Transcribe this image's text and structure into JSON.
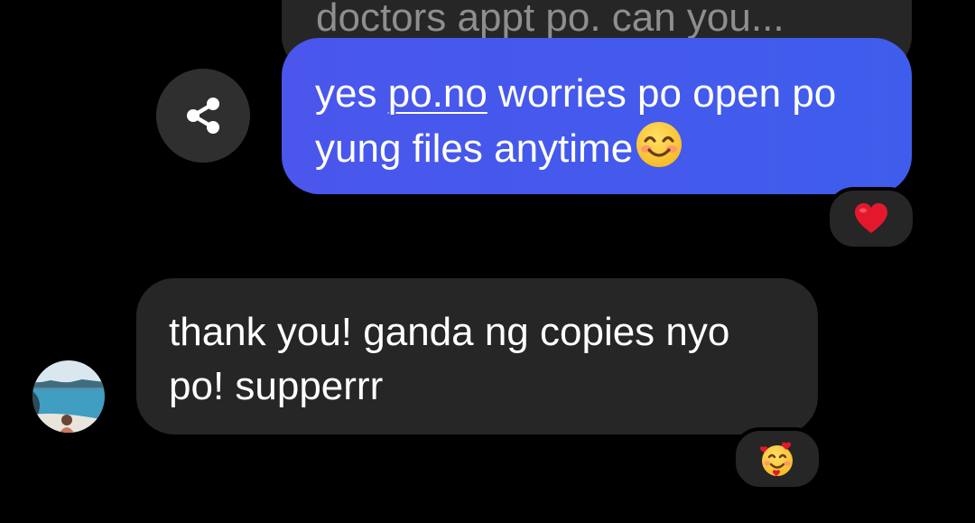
{
  "thread": {
    "previous_message_partial": "doctors appt po. can you...",
    "sent_message": {
      "text_before_link": "yes ",
      "link_text": "po.no",
      "text_after_link": " worries po open po yung files anytime",
      "trailing_emoji": "smiling-face-with-smiling-eyes",
      "reaction": "red-heart"
    },
    "received_message": {
      "text": "thank you! ganda ng copies nyo po! supperrr",
      "reaction": "smiling-face-with-hearts"
    }
  },
  "icons": {
    "share": "share-icon"
  },
  "colors": {
    "background": "#000000",
    "sent_bubble": "#4458ec",
    "received_bubble": "#262626",
    "previous_text": "#8e8e8e",
    "share_button": "#2f2f2f"
  }
}
